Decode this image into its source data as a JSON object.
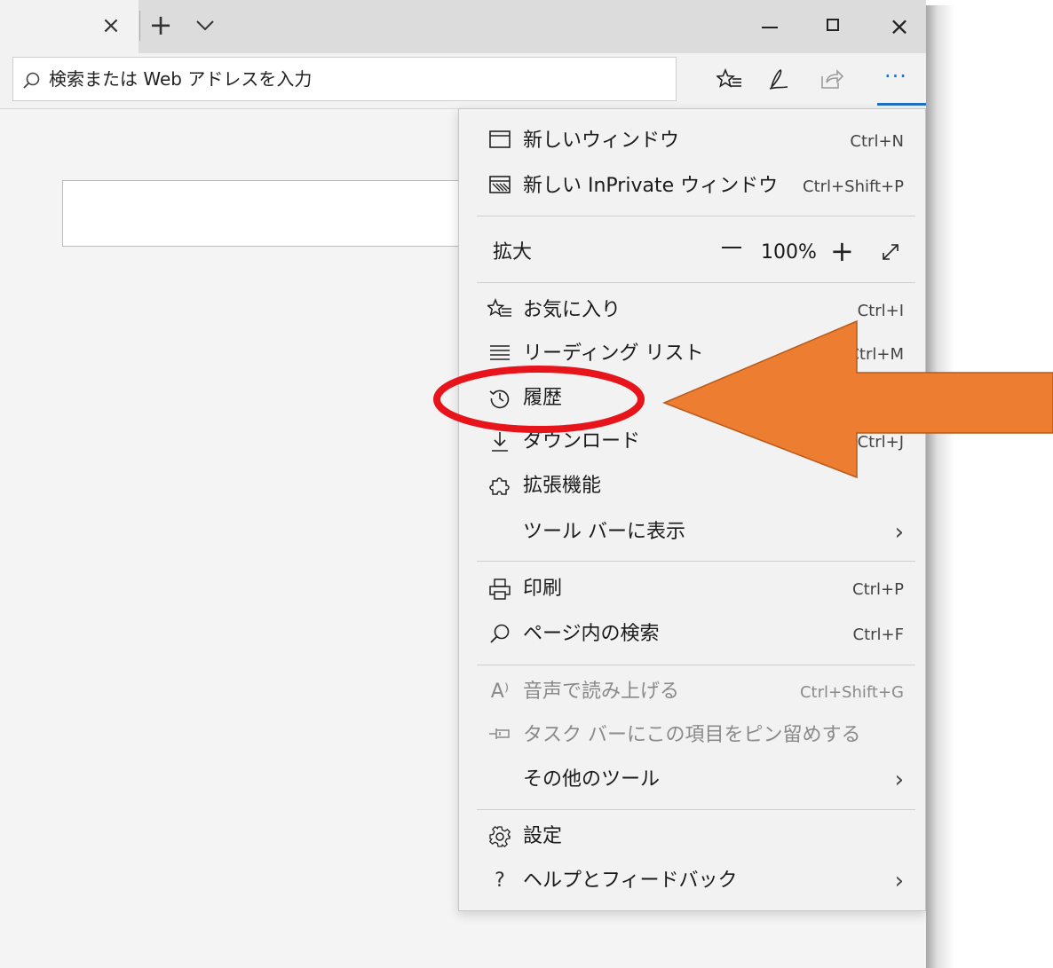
{
  "tabbar": {
    "close_tab_glyph": "×",
    "new_tab_glyph": "+",
    "tab_dropdown_icon": "chevron-down-icon",
    "window_close_glyph": "×"
  },
  "address_bar": {
    "placeholder": "検索または Web アドレスを入力",
    "tools": [
      "favorites-icon",
      "pen-icon",
      "share-icon",
      "more-icon"
    ],
    "more_glyph": "···"
  },
  "menu": {
    "new_window": {
      "label": "新しいウィンドウ",
      "shortcut": "Ctrl+N"
    },
    "new_inprivate": {
      "label": "新しい InPrivate ウィンドウ",
      "shortcut": "Ctrl+Shift+P"
    },
    "zoom": {
      "label": "拡大",
      "minus": "—",
      "value": "100%",
      "plus": "+"
    },
    "favorites": {
      "label": "お気に入り",
      "shortcut": "Ctrl+I"
    },
    "reading_list": {
      "label": "リーディング リスト",
      "shortcut": "Ctrl+M"
    },
    "history": {
      "label": "履歴"
    },
    "downloads": {
      "label": "ダウンロード",
      "shortcut": "Ctrl+J"
    },
    "extensions": {
      "label": "拡張機能"
    },
    "show_in_toolbar": {
      "label": "ツール バーに表示"
    },
    "print": {
      "label": "印刷",
      "shortcut": "Ctrl+P"
    },
    "find_on_page": {
      "label": "ページ内の検索",
      "shortcut": "Ctrl+F"
    },
    "read_aloud": {
      "label": "音声で読み上げる",
      "shortcut": "Ctrl+Shift+G",
      "icon_text": "A⁾"
    },
    "pin_taskbar": {
      "label": "タスク バーにこの項目をピン留めする"
    },
    "more_tools": {
      "label": "その他のツール"
    },
    "settings": {
      "label": "設定"
    },
    "help": {
      "label": "ヘルプとフィードバック",
      "icon_text": "?"
    },
    "chevron": "›"
  },
  "colors": {
    "accent": "#1f6fc4",
    "highlight_ellipse": "#e8141b",
    "arrow_fill": "#ed7d31",
    "arrow_stroke": "#b85a1c"
  }
}
